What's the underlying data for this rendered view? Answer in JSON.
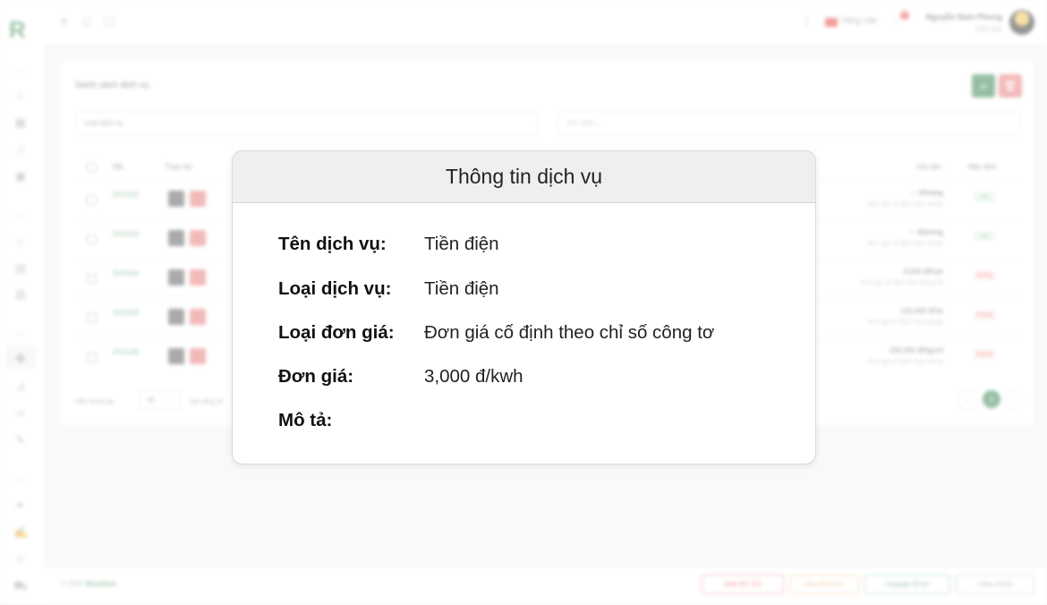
{
  "app": {
    "logo": "R",
    "copyright_prefix": "© 2022",
    "copyright_brand": "Resident"
  },
  "topbar": {
    "language": "Tiếng Việt",
    "notification_count": "0",
    "user_name": "Nguyễn Nam Phong",
    "user_role": "Chủ nhà"
  },
  "list": {
    "title": "Danh sách dịch vụ",
    "add_label": "+",
    "delete_label": "🗑",
    "type_select_value": "Loại dịch vụ",
    "search_placeholder": "Tìm kiếm...",
    "columns": {
      "code": "Mã",
      "actions": "Thao tác",
      "price": "Giá tiền",
      "default": "Mặc định"
    },
    "rows": [
      {
        "code": "DV0102",
        "price": "--- đ/tháng",
        "price_note": "Đơn giá cố định theo tháng",
        "default": "Có",
        "default_on": true
      },
      {
        "code": "DV0103",
        "price": "--- đ/phòng",
        "price_note": "Đơn giá cố định theo tháng",
        "default": "Có",
        "default_on": true
      },
      {
        "code": "DV0104",
        "price": "3,000 đ/Kwh",
        "price_note": "Đơn giá cố định theo đồng hồ",
        "default": "Không",
        "default_on": false
      },
      {
        "code": "DV0106",
        "price": "120,000 đ/Xe",
        "price_note": "Đơn giá cố định theo tháng",
        "default": "Không",
        "default_on": false
      },
      {
        "code": "DV0136",
        "price": "200,000 đ/Người",
        "price_note": "Đơn giá cố định theo tháng",
        "default": "Không",
        "default_on": false
      }
    ],
    "show_label": "Hiển thị tối đa",
    "page_size": "50",
    "total_label": "trên tổng số",
    "current_page": "1"
  },
  "footer_buttons": {
    "hotline": "0888 887 263",
    "support": "Báo lỗi hỗ trợ",
    "fanpage": "Fanpage hỗ trợ",
    "video": "Video HDSD"
  },
  "modal": {
    "title": "Thông tin dịch vụ",
    "fields": [
      {
        "label": "Tên dịch vụ:",
        "value": "Tiền điện"
      },
      {
        "label": "Loại dịch vụ:",
        "value": "Tiền điện"
      },
      {
        "label": "Loại đơn giá:",
        "value": "Đơn giá cố định theo chỉ số công tơ"
      },
      {
        "label": "Đơn giá:",
        "value": "3,000 đ/kwh"
      },
      {
        "label": "Mô tả:",
        "value": ""
      }
    ]
  }
}
